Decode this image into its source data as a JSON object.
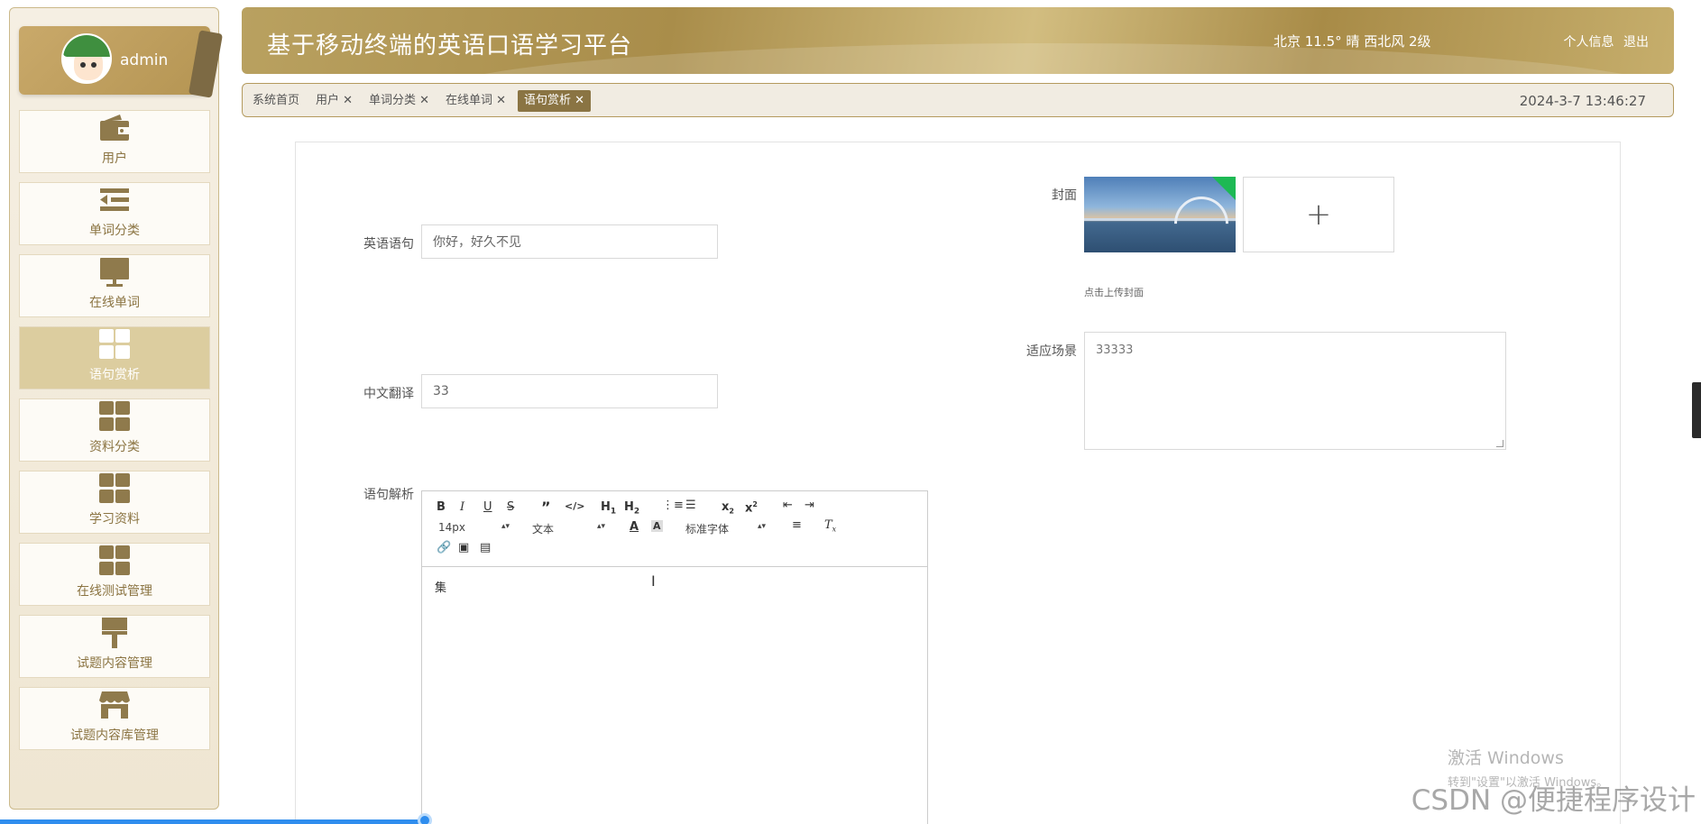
{
  "user": {
    "name": "admin"
  },
  "sidebar": {
    "items": [
      {
        "label": "用户",
        "icon": "wallet-icon",
        "active": false
      },
      {
        "label": "单词分类",
        "icon": "list-indent-icon",
        "active": false
      },
      {
        "label": "在线单词",
        "icon": "monitor-icon",
        "active": false
      },
      {
        "label": "语句赏析",
        "icon": "grid-icon",
        "active": true
      },
      {
        "label": "资料分类",
        "icon": "grid-icon",
        "active": false
      },
      {
        "label": "学习资料",
        "icon": "grid-icon",
        "active": false
      },
      {
        "label": "在线测试管理",
        "icon": "grid-icon",
        "active": false
      },
      {
        "label": "试题内容管理",
        "icon": "brush-icon",
        "active": false
      },
      {
        "label": "试题内容库管理",
        "icon": "store-icon",
        "active": false
      }
    ]
  },
  "header": {
    "title": "基于移动终端的英语口语学习平台",
    "weather": "北京  11.5°  晴  西北风  2级",
    "profile_link": "个人信息",
    "logout_link": "退出"
  },
  "tabs": [
    {
      "label": "系统首页",
      "closable": false,
      "active": false
    },
    {
      "label": "用户 ✕",
      "closable": true,
      "active": false
    },
    {
      "label": "单词分类 ✕",
      "closable": true,
      "active": false
    },
    {
      "label": "在线单词 ✕",
      "closable": true,
      "active": false
    },
    {
      "label": "语句赏析 ✕",
      "closable": true,
      "active": true
    }
  ],
  "datetime": "2024-3-7 13:46:27",
  "form": {
    "english_sentence": {
      "label": "英语语句",
      "value": "你好，好久不见"
    },
    "chinese_translation": {
      "label": "中文翻译",
      "value": "33"
    },
    "cover": {
      "label": "封面",
      "hint": "点击上传封面",
      "add_symbol": "+"
    },
    "scenario": {
      "label": "适应场景",
      "value": "33333"
    },
    "analysis": {
      "label": "语句解析",
      "content": "集"
    }
  },
  "editor": {
    "font_size": "14px",
    "text_type": "文本",
    "font_family": "标准字体"
  },
  "watermark": {
    "line1": "激活 Windows",
    "line2": "转到\"设置\"以激活 Windows。",
    "site": "CSDN @便捷程序设计"
  },
  "colors": {
    "accent": "#8a7443",
    "header_gold": "#b59553",
    "active_menu": "#dccd9f"
  }
}
